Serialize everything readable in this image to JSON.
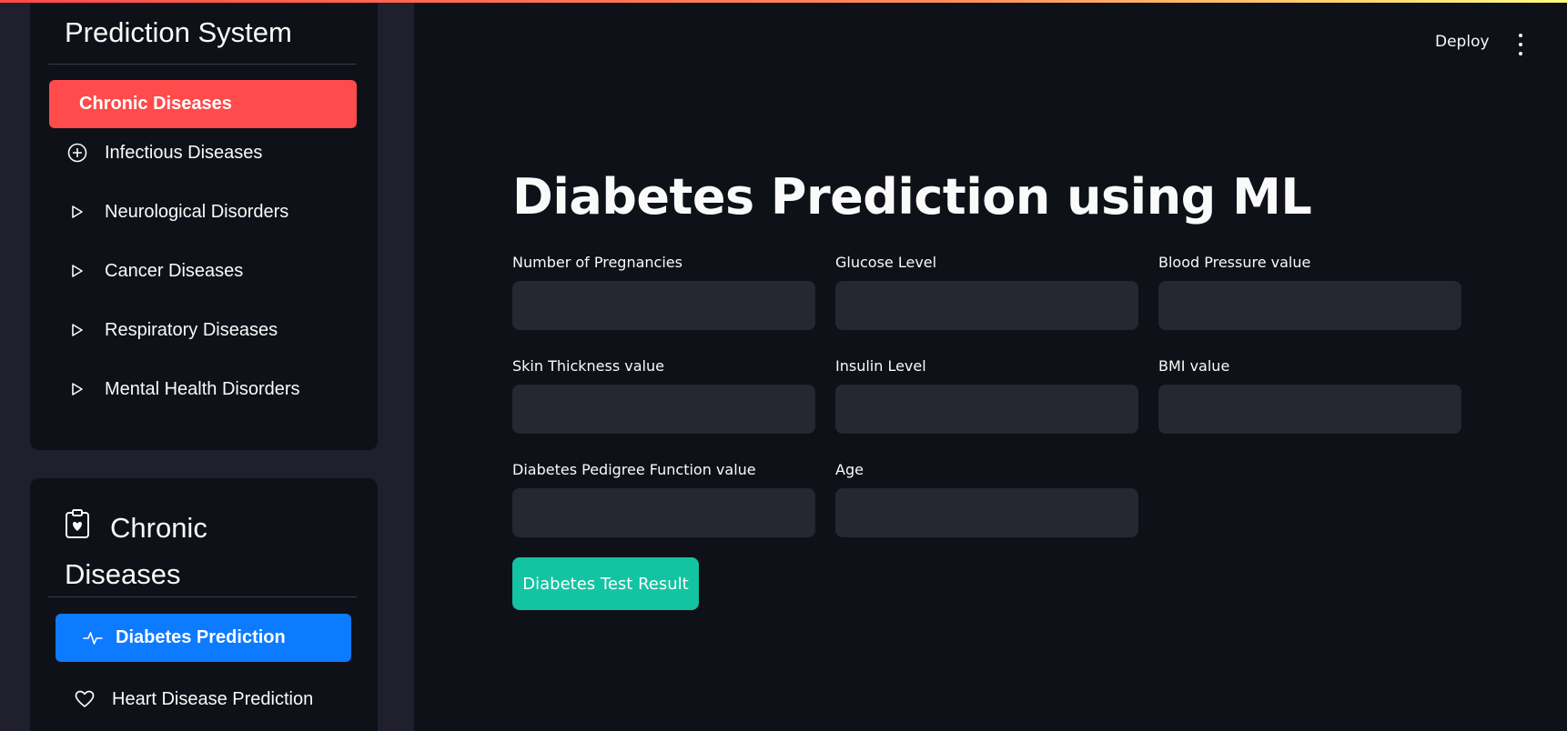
{
  "header": {
    "deploy_label": "Deploy",
    "more_icon": "kebab-menu-icon"
  },
  "sidebar": {
    "main_menu": {
      "title": "Prediction System",
      "active": {
        "label": "Chronic Diseases",
        "color": "#ff4b4b"
      },
      "items": [
        {
          "label": "Infectious Diseases",
          "icon": "plus-circle-icon"
        },
        {
          "label": "Neurological Disorders",
          "icon": "play-icon"
        },
        {
          "label": "Cancer Diseases",
          "icon": "play-icon"
        },
        {
          "label": "Respiratory Diseases",
          "icon": "play-icon"
        },
        {
          "label": "Mental Health Disorders",
          "icon": "play-icon"
        }
      ]
    },
    "sub_menu": {
      "title_icon": "clipboard-heart-icon",
      "title_line1": "Chronic",
      "title_line2": "Diseases",
      "active": {
        "label": "Diabetes Prediction",
        "icon": "activity-icon",
        "color": "#0d7bff"
      },
      "items": [
        {
          "label": "Heart Disease Prediction",
          "icon": "heart-icon"
        }
      ]
    }
  },
  "main": {
    "title": "Diabetes Prediction using ML",
    "fields": [
      {
        "label": "Number of Pregnancies",
        "value": ""
      },
      {
        "label": "Glucose Level",
        "value": ""
      },
      {
        "label": "Blood Pressure value",
        "value": ""
      },
      {
        "label": "Skin Thickness value",
        "value": ""
      },
      {
        "label": "Insulin Level",
        "value": ""
      },
      {
        "label": "BMI value",
        "value": ""
      },
      {
        "label": "Diabetes Pedigree Function value",
        "value": ""
      },
      {
        "label": "Age",
        "value": ""
      }
    ],
    "submit_label": "Diabetes Test Result",
    "submit_color": "#13c4a3"
  }
}
